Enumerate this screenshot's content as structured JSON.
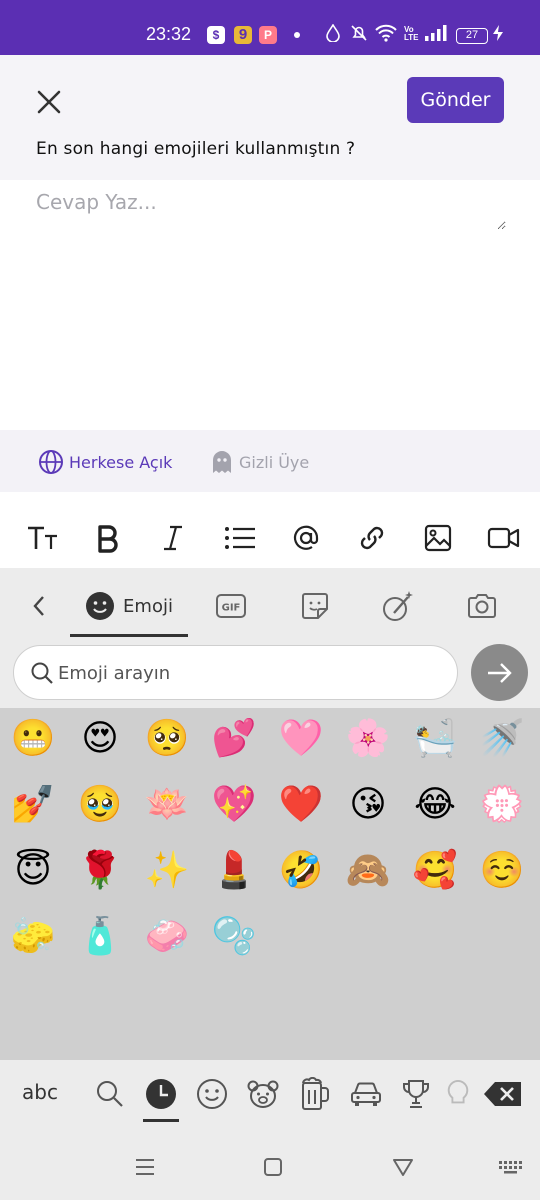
{
  "status_bar": {
    "time": "23:32",
    "app_icons": [
      "$",
      "9",
      "P"
    ],
    "battery": "27",
    "network_label": "Vo LTE"
  },
  "header": {
    "send_label": "Gönder",
    "question": "En son hangi emojileri kullanmıştın ?"
  },
  "answer": {
    "placeholder": "Cevap Yaz..."
  },
  "privacy": {
    "public_label": "Herkese Açık",
    "anonymous_label": "Gizli Üye"
  },
  "keyboard": {
    "emoji_tab_label": "Emoji",
    "gif_label": "GIF",
    "search_placeholder": "Emoji arayın",
    "abc_label": "abc",
    "emojis": [
      {
        "char": "😬",
        "variants": false
      },
      {
        "char": "😍",
        "variants": false
      },
      {
        "char": "🥺",
        "variants": false
      },
      {
        "char": "💕",
        "variants": false
      },
      {
        "char": "🩷",
        "variants": false
      },
      {
        "char": "🌸",
        "variants": false
      },
      {
        "char": "🛀",
        "variants": true
      },
      {
        "char": "🚿",
        "variants": false
      },
      {
        "char": "💅",
        "variants": true
      },
      {
        "char": "🥹",
        "variants": false
      },
      {
        "char": "🪷",
        "variants": false
      },
      {
        "char": "💖",
        "variants": false
      },
      {
        "char": "❤️",
        "variants": false
      },
      {
        "char": "😘",
        "variants": false
      },
      {
        "char": "😂",
        "variants": false
      },
      {
        "char": "💮",
        "variants": false
      },
      {
        "char": "😇",
        "variants": false
      },
      {
        "char": "🌹",
        "variants": false
      },
      {
        "char": "✨",
        "variants": false
      },
      {
        "char": "💄",
        "variants": false
      },
      {
        "char": "🤣",
        "variants": false
      },
      {
        "char": "🙈",
        "variants": false
      },
      {
        "char": "🥰",
        "variants": false
      },
      {
        "char": "☺️",
        "variants": false
      },
      {
        "char": "🧽",
        "variants": false
      },
      {
        "char": "🧴",
        "variants": false
      },
      {
        "char": "🧼",
        "variants": false
      },
      {
        "char": "🫧",
        "variants": false
      }
    ]
  },
  "colors": {
    "brand": "#5b3ab8",
    "status_bar": "#5b2fb3",
    "muted": "#a3a3ad"
  }
}
